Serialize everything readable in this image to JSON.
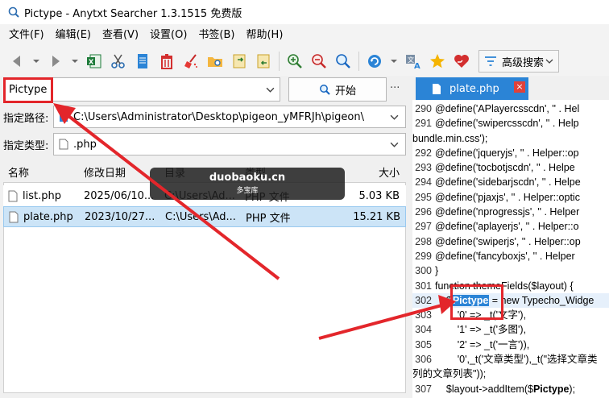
{
  "window": {
    "title": "Pictype - Anytxt Searcher 1.3.1515 免费版"
  },
  "menu": [
    "文件(F)",
    "编辑(E)",
    "查看(V)",
    "设置(O)",
    "书签(B)",
    "帮助(H)"
  ],
  "toolbar": {
    "advanced_search_label": "高级搜索"
  },
  "search": {
    "query": "Pictype",
    "start_label": "开始",
    "more_label": "···"
  },
  "path": {
    "label": "指定路径:",
    "value": "C:\\Users\\Administrator\\Desktop\\pigeon_yMFRJh\\pigeon\\"
  },
  "filetype": {
    "label": "指定类型:",
    "value": ".php"
  },
  "list": {
    "headers": {
      "name": "名称",
      "date": "修改日期",
      "dir": "目录",
      "type": "类型",
      "size": "大小"
    },
    "rows": [
      {
        "name": "list.php",
        "date": "2025/06/10...",
        "dir": "C:\\Users\\Ad...",
        "type": "PHP 文件",
        "size": "5.03 KB"
      },
      {
        "name": "plate.php",
        "date": "2023/10/27...",
        "dir": "C:\\Users\\Ad...",
        "type": "PHP 文件",
        "size": "15.21 KB"
      }
    ]
  },
  "preview": {
    "tab_label": "plate.php",
    "close_label": "×",
    "lines": [
      {
        "n": "290",
        "t": "    @define('APlayercsscdn',  '' . Hel"
      },
      {
        "n": "291",
        "t": "    @define('swipercsscdn',  '' . Help"
      },
      {
        "n": "",
        "t": "bundle.min.css');"
      },
      {
        "n": "292",
        "t": "    @define('jqueryjs',  '' . Helper::op"
      },
      {
        "n": "293",
        "t": "    @define('tocbotjscdn',  '' . Helpe"
      },
      {
        "n": "294",
        "t": "    @define('sidebarjscdn',  '' . Helpe"
      },
      {
        "n": "295",
        "t": "    @define('pjaxjs',  '' . Helper::optic"
      },
      {
        "n": "296",
        "t": "    @define('nprogressjs',  '' . Helper"
      },
      {
        "n": "297",
        "t": "    @define('aplayerjs',  '' . Helper::o"
      },
      {
        "n": "298",
        "t": "    @define('swiperjs',  '' . Helper::op"
      },
      {
        "n": "299",
        "t": "    @define('fancyboxjs',  '' . Helper"
      },
      {
        "n": "300",
        "t": "}"
      },
      {
        "n": "301",
        "t": "function themeFields($layout) {"
      }
    ],
    "line302": {
      "n": "302",
      "pre": "    $",
      "hit": "Pictype",
      "post": " = new Typecho_Widge"
    },
    "lines_after": [
      {
        "n": "303",
        "t": "        '0' => _t('文字'),"
      },
      {
        "n": "304",
        "t": "        '1' => _t('多图'),"
      },
      {
        "n": "305",
        "t": "        '2' => _t('一言')),"
      },
      {
        "n": "306",
        "t": "        '0',_t('文章类型'),_t(\"选择文章类"
      },
      {
        "n": "",
        "t": "列的文章列表\"));"
      }
    ],
    "line307": {
      "n": "307",
      "pre": "    $layout->addItem($",
      "hit": "Pictype",
      "post": ");"
    }
  },
  "watermark": {
    "line1": "duobaoku.cn",
    "line2": "多宝库"
  },
  "colors": {
    "accent": "#2b84d6",
    "annotation": "#e3262b",
    "selection": "#cce4f7"
  }
}
